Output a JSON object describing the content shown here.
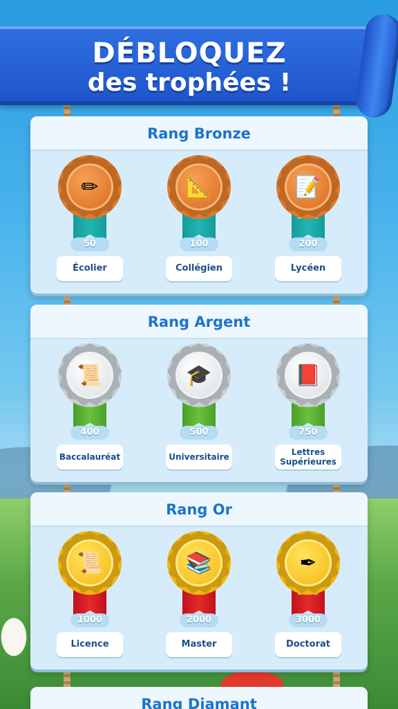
{
  "header": {
    "line1": "DÉBLOQUEZ",
    "line2": "des trophées !"
  },
  "ranks": [
    {
      "title": "Rang Bronze",
      "tier": "bronze",
      "trophies": [
        {
          "icon": "pencil-icon",
          "glyph": "✏",
          "stars": "★",
          "points": "50",
          "label": "Écolier"
        },
        {
          "icon": "ruler-pencil-icon",
          "glyph": "📐",
          "stars": "★★",
          "points": "100",
          "label": "Collégien"
        },
        {
          "icon": "notes-icon",
          "glyph": "📝",
          "stars": "★★★",
          "points": "200",
          "label": "Lycéen"
        }
      ]
    },
    {
      "title": "Rang Argent",
      "tier": "silver",
      "trophies": [
        {
          "icon": "diploma-scroll-icon",
          "glyph": "📜",
          "stars": "★",
          "points": "400",
          "label": "Baccalauréat"
        },
        {
          "icon": "graduation-cap-icon",
          "glyph": "🎓",
          "stars": "★★",
          "points": "500",
          "label": "Universitaire"
        },
        {
          "icon": "book-icon",
          "glyph": "📕",
          "stars": "★★★",
          "points": "750",
          "label": "Lettres Supérieures"
        }
      ]
    },
    {
      "title": "Rang Or",
      "tier": "gold",
      "trophies": [
        {
          "icon": "scroll-icon",
          "glyph": "📜",
          "stars": "★",
          "points": "1000",
          "label": "Licence"
        },
        {
          "icon": "cap-books-icon",
          "glyph": "📚",
          "stars": "★★",
          "points": "2000",
          "label": "Master"
        },
        {
          "icon": "quill-scroll-icon",
          "glyph": "✒",
          "stars": "★★★",
          "points": "3000",
          "label": "Doctorat"
        }
      ]
    },
    {
      "title": "Rang Diamant",
      "tier": "diamond",
      "trophies": []
    }
  ]
}
